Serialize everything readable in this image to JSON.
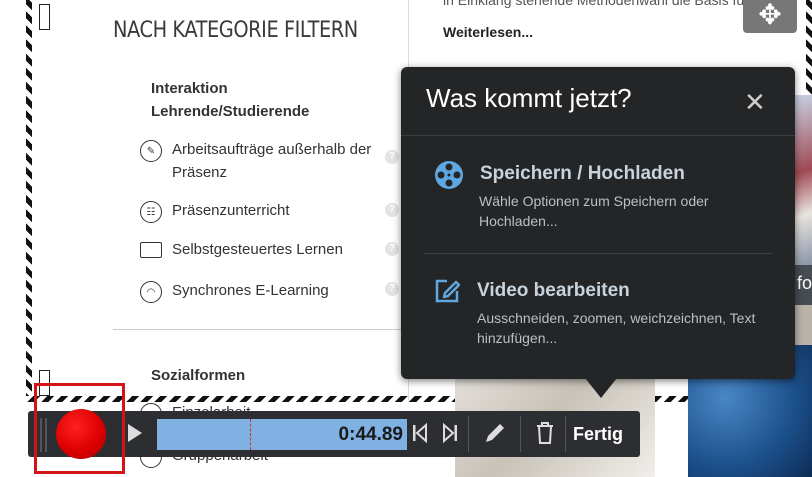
{
  "left_panel": {
    "title": "NACH KATEGORIE FILTERN",
    "section1_heading": "Interaktion Lehrende/Studierende",
    "items": [
      {
        "label": "Arbeitsaufträge außerhalb der Präsenz",
        "icon": "edit-doc-icon"
      },
      {
        "label": "Präsenzunterricht",
        "icon": "classroom-icon"
      },
      {
        "label": "Selbstgesteuertes Lernen",
        "icon": "laptop-icon"
      },
      {
        "label": "Synchrones E-Learning",
        "icon": "headset-icon"
      }
    ],
    "help_glyph": "?",
    "section2_heading": "Sozialformen",
    "items2": [
      {
        "label": "Einzelarbeit",
        "icon": "person-icon"
      },
      {
        "label": "Gruppenarbeit",
        "icon": "group-icon"
      }
    ]
  },
  "right_content": {
    "top_text": "in Einklang stehende Methodenwahl die Basis für ...",
    "read_more": "Weiterlesen...",
    "side_text": "fo"
  },
  "popup": {
    "title": "Was kommt jetzt?",
    "close_glyph": "✕",
    "options": [
      {
        "title": "Speichern / Hochladen",
        "description": "Wähle Optionen zum Speichern oder Hochladen...",
        "icon": "film-reel-icon"
      },
      {
        "title": "Video bearbeiten",
        "description": "Ausschneiden, zoomen, weichzeichnen, Text hinzufügen...",
        "icon": "edit-pencil-icon"
      }
    ]
  },
  "toolbar": {
    "time": "0:44.89",
    "done_label": "Fertig",
    "progress": 0.37
  },
  "colors": {
    "accent_blue": "#7fb1e3",
    "record_red": "#d4121a",
    "popup_bg": "#232527"
  }
}
